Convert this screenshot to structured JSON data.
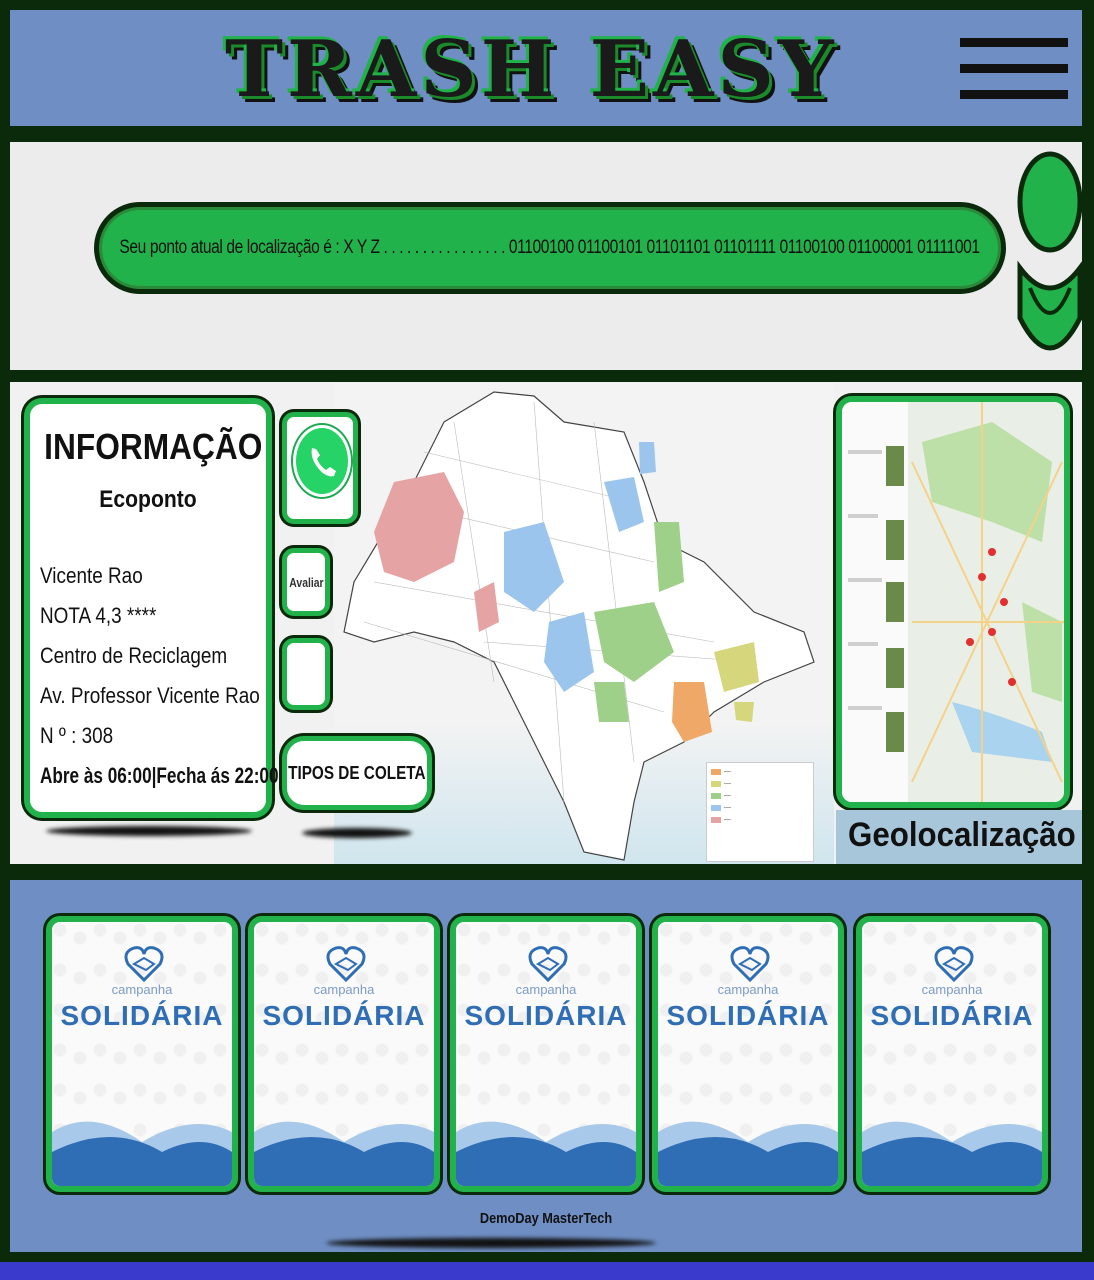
{
  "header": {
    "title": "TRASH EASY",
    "menu_icon": "hamburger-menu-icon"
  },
  "location": {
    "text": "Seu ponto atual de localização é :   X Y Z . . . . . . . .       . . . .       . . . . 01100100 01100101 01101101 01101111 01100100 01100001 01111001"
  },
  "info": {
    "title": "INFORMAÇÃO",
    "subtitle": "Ecoponto",
    "lines": [
      "Vicente Rao",
      "NOTA 4,3    ****",
      "Centro de Reciclagem",
      "Av. Professor Vicente Rao",
      "N º : 308",
      "Abre às 06:00|Fecha ás 22:00"
    ]
  },
  "actions": {
    "avaliar": "Avaliar",
    "tipos": "TIPOS DE COLETA",
    "whatsapp_icon": "whatsapp-icon"
  },
  "geo": {
    "label": "Geolocalização"
  },
  "campaign": {
    "line1": "campanha",
    "line2": "SOLIDÁRIA",
    "count": 5
  },
  "footer": {
    "text": "DemoDay MasterTech"
  },
  "colors": {
    "brand_green": "#22b24c",
    "band_blue": "#6f8fc4",
    "dark": "#0b2a0b"
  }
}
